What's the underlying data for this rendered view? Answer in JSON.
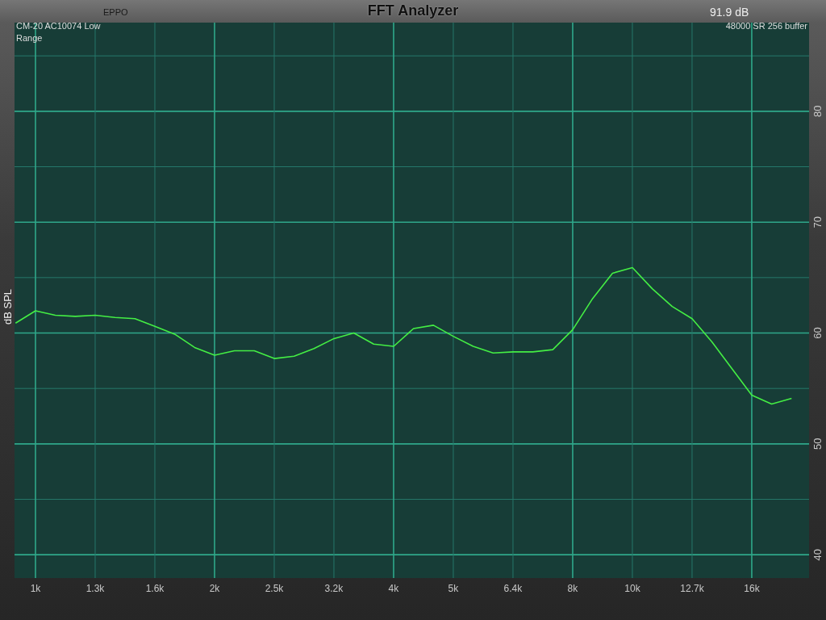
{
  "header": {
    "app_name": "EPPO",
    "title": "FFT Analyzer",
    "level_reading": "91.9 dB"
  },
  "plot": {
    "device_lines": [
      "CM-20 AC10074 Low",
      "Range"
    ],
    "stream_info": "48000 SR 256 buffer",
    "chart_data": {
      "type": "line",
      "ylabel": "dB SPL",
      "categories": [
        null,
        "1k",
        null,
        null,
        "1.3k",
        null,
        null,
        "1.6k",
        null,
        null,
        "2k",
        null,
        null,
        "2.5k",
        null,
        null,
        "3.2k",
        null,
        null,
        "4k",
        null,
        null,
        "5k",
        null,
        null,
        "6.4k",
        null,
        null,
        "8k",
        null,
        null,
        "10k",
        null,
        null,
        "12.7k",
        null,
        null,
        "16k",
        null,
        null
      ],
      "series": [
        {
          "color": "#44ee44",
          "values": [
            60.9,
            62.0,
            61.6,
            61.5,
            61.6,
            61.4,
            61.3,
            60.6,
            59.9,
            58.7,
            58.0,
            58.4,
            58.4,
            57.7,
            57.9,
            58.6,
            59.5,
            60.0,
            59.0,
            58.8,
            60.4,
            60.7,
            59.7,
            58.8,
            58.2,
            58.3,
            58.3,
            58.5,
            60.3,
            63.1,
            65.4,
            65.9,
            64.0,
            62.4,
            61.3,
            59.2,
            56.8,
            54.4,
            53.6,
            54.1
          ]
        }
      ],
      "ylim": [
        37.9,
        88
      ],
      "grid": true,
      "yticks": [
        40,
        50,
        60,
        70,
        80
      ]
    }
  }
}
